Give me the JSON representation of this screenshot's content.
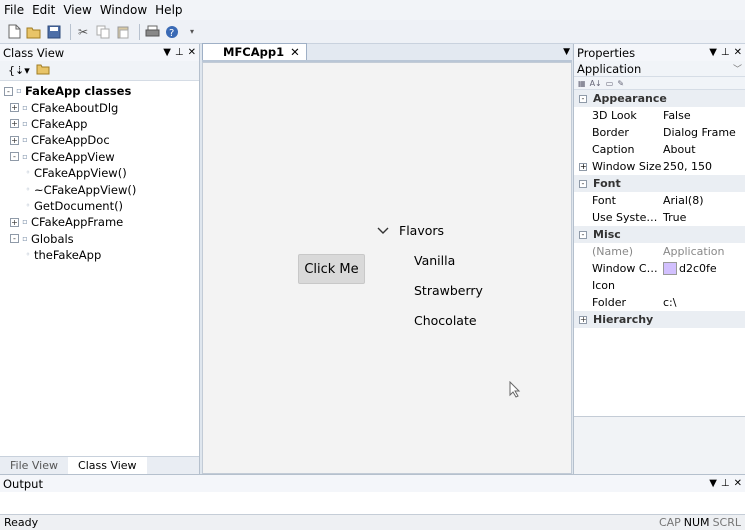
{
  "menu": [
    "File",
    "Edit",
    "View",
    "Window",
    "Help"
  ],
  "class_view": {
    "title": "Class View",
    "tree": [
      {
        "label": "FakeApp classes",
        "level": 0,
        "expander": "-",
        "bold": true
      },
      {
        "label": "CFakeAboutDlg",
        "level": 1,
        "expander": "+"
      },
      {
        "label": "CFakeApp",
        "level": 1,
        "expander": "+"
      },
      {
        "label": "CFakeAppDoc",
        "level": 1,
        "expander": "+"
      },
      {
        "label": "CFakeAppView",
        "level": 1,
        "expander": "-"
      },
      {
        "label": "CFakeAppView()",
        "level": 2,
        "expander": ""
      },
      {
        "label": "~CFakeAppView()",
        "level": 2,
        "expander": ""
      },
      {
        "label": "GetDocument()",
        "level": 2,
        "expander": ""
      },
      {
        "label": "CFakeAppFrame",
        "level": 1,
        "expander": "+"
      },
      {
        "label": "Globals",
        "level": 1,
        "expander": "-"
      },
      {
        "label": "theFakeApp",
        "level": 2,
        "expander": ""
      }
    ],
    "tabs": [
      {
        "label": "File View",
        "active": false
      },
      {
        "label": "Class View",
        "active": true
      }
    ]
  },
  "document": {
    "tab_label": "MFCApp1",
    "button_label": "Click Me",
    "tree_root": "Flavors",
    "tree_children": [
      "Vanilla",
      "Strawberry",
      "Chocolate"
    ]
  },
  "properties": {
    "title": "Properties",
    "object": "Application",
    "rows": [
      {
        "type": "category",
        "label": "Appearance",
        "expander": "-"
      },
      {
        "type": "prop",
        "name": "3D Look",
        "value": "False"
      },
      {
        "type": "prop",
        "name": "Border",
        "value": "Dialog Frame"
      },
      {
        "type": "prop",
        "name": "Caption",
        "value": "About"
      },
      {
        "type": "prop",
        "name": "Window Size",
        "value": "250, 150",
        "expander": "+"
      },
      {
        "type": "category",
        "label": "Font",
        "expander": "-"
      },
      {
        "type": "prop",
        "name": "Font",
        "value": "Arial(8)"
      },
      {
        "type": "prop",
        "name": "Use System...",
        "value": "True"
      },
      {
        "type": "category",
        "label": "Misc",
        "expander": "-"
      },
      {
        "type": "prop",
        "name": "(Name)",
        "value": "Application",
        "muted": true
      },
      {
        "type": "prop",
        "name": "Window Co...",
        "value": "d2c0fe",
        "swatch": "#d2c0fe"
      },
      {
        "type": "prop",
        "name": "Icon",
        "value": ""
      },
      {
        "type": "prop",
        "name": "Folder",
        "value": "c:\\"
      },
      {
        "type": "category",
        "label": "Hierarchy",
        "expander": "+"
      }
    ]
  },
  "output": {
    "title": "Output"
  },
  "status": {
    "text": "Ready",
    "indicators": [
      {
        "label": "CAP",
        "on": false
      },
      {
        "label": "NUM",
        "on": true
      },
      {
        "label": "SCRL",
        "on": false
      }
    ]
  },
  "colors": {
    "accent": "#d2c0fe",
    "chrome": "#dfe6ee"
  }
}
